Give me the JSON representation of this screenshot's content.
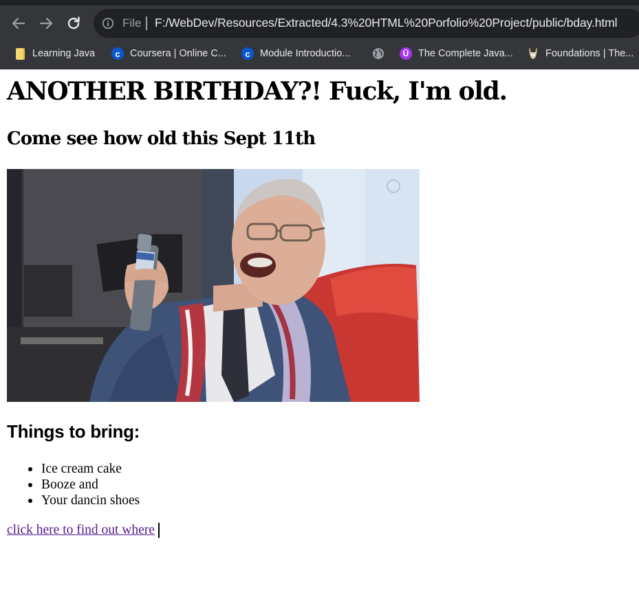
{
  "browser": {
    "address_bar": {
      "scheme_label": "File",
      "url": "F:/WebDev/Resources/Extracted/4.3%20HTML%20Porfolio%20Project/public/bday.html"
    },
    "bookmarks": [
      {
        "label": "Learning Java",
        "icon": "folder-icon"
      },
      {
        "label": "Coursera | Online C...",
        "icon": "coursera-icon"
      },
      {
        "label": "Module Introductio...",
        "icon": "coursera-icon"
      },
      {
        "label": "",
        "icon": "globe-icon"
      },
      {
        "label": "The Complete Java...",
        "icon": "udemy-icon"
      },
      {
        "label": "Foundations | The...",
        "icon": "odin-icon"
      }
    ]
  },
  "page": {
    "heading": "ANOTHER BIRTHDAY?! Fuck, I'm old.",
    "subheading": "Come see how old this Sept 11th",
    "image_icon": "old-man-toasting-bottle-gif",
    "bring_heading": "Things to bring:",
    "bring_items": [
      "Ice cream cake",
      "Booze and",
      "Your dancin shoes"
    ],
    "link_text": "click here to find out where"
  },
  "colors": {
    "chrome_bg": "#35363a",
    "omnibox_bg": "#202124",
    "link_visited": "#551a8b"
  }
}
